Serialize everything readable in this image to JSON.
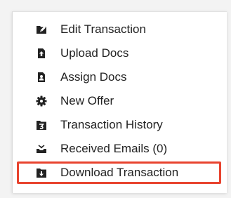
{
  "menu": {
    "items": [
      {
        "label": "Edit Transaction",
        "icon": "folder-edit-icon"
      },
      {
        "label": "Upload Docs",
        "icon": "file-upload-icon"
      },
      {
        "label": "Assign Docs",
        "icon": "assign-docs-icon"
      },
      {
        "label": "New Offer",
        "icon": "gear-icon"
      },
      {
        "label": "Transaction History",
        "icon": "history-icon"
      },
      {
        "label": "Received Emails (0)",
        "icon": "email-tray-icon"
      },
      {
        "label": "Download Transaction",
        "icon": "download-box-icon"
      }
    ],
    "highlighted_item": "Download Transaction",
    "highlight_color": "#e8432e",
    "icon_color": "#222222"
  }
}
